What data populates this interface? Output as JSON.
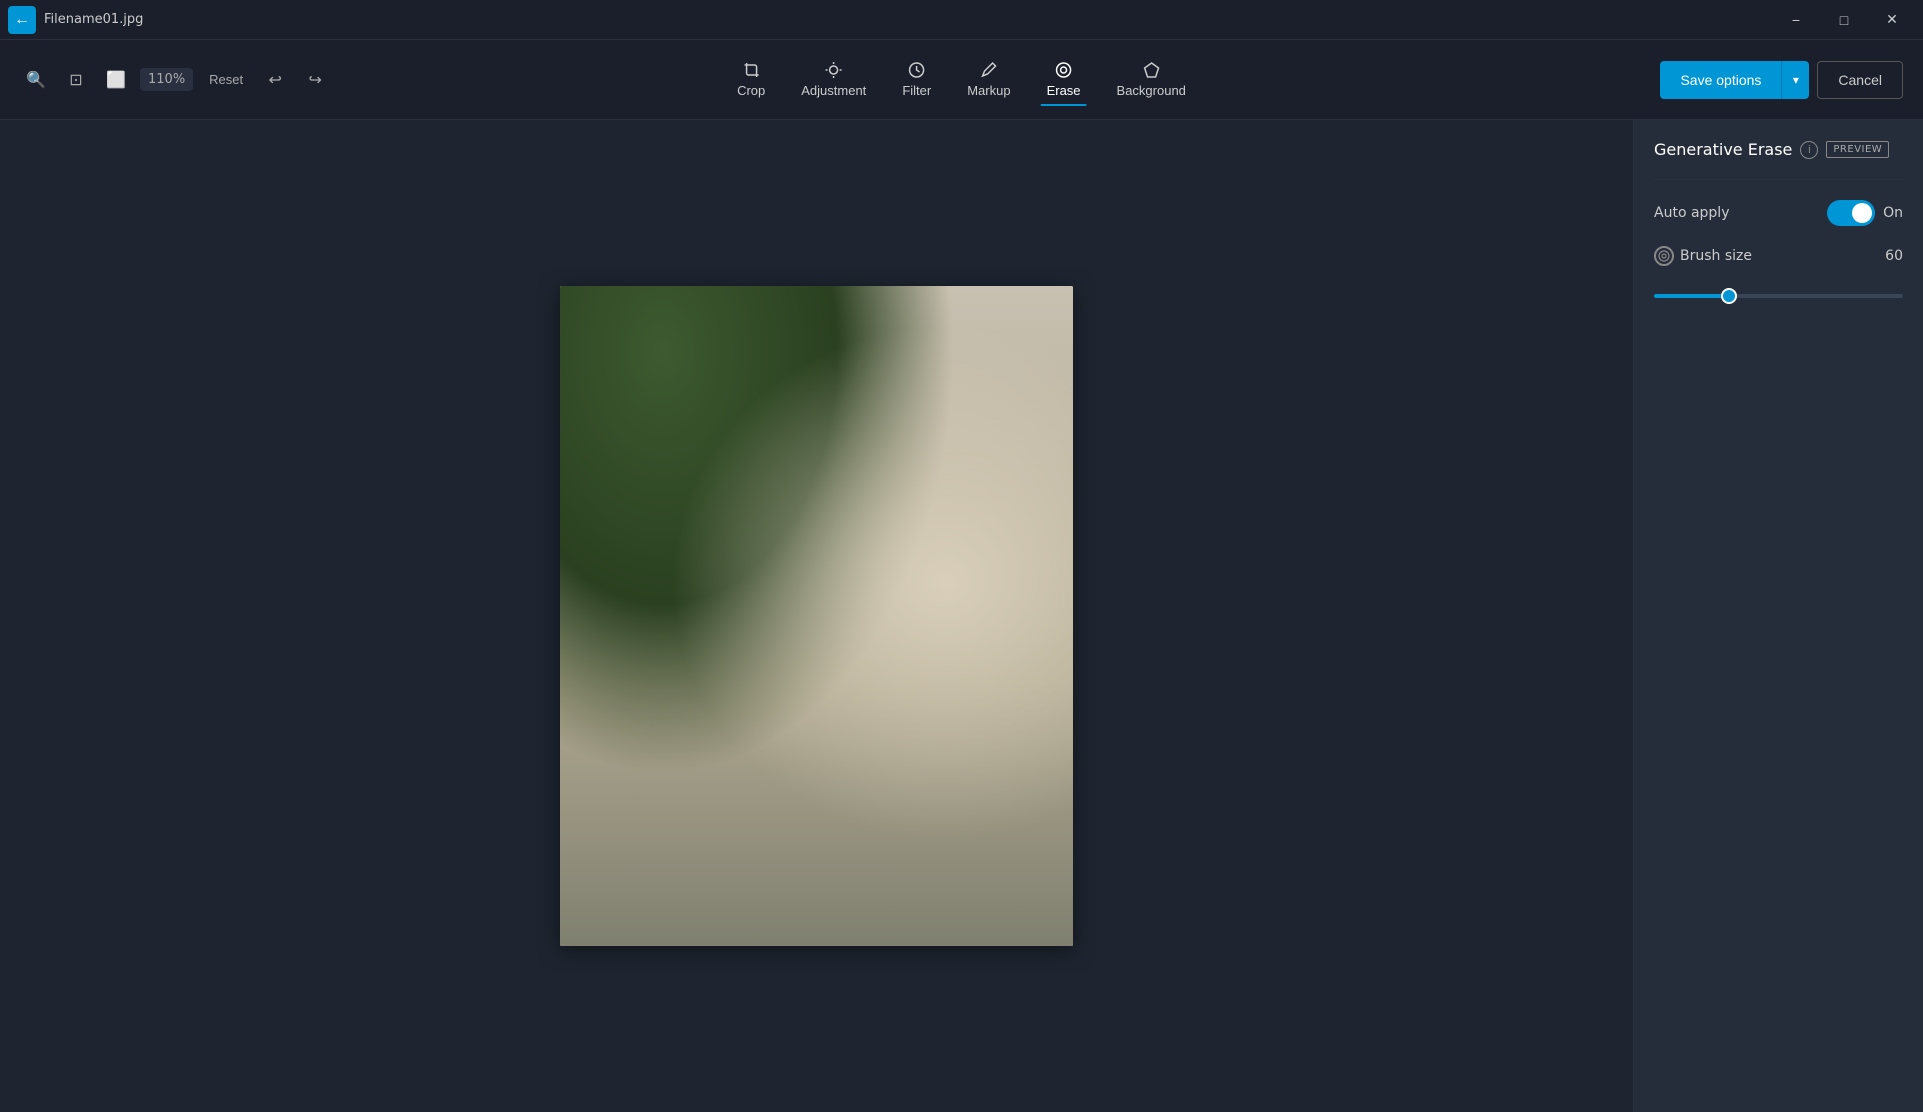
{
  "titleBar": {
    "filename": "Filename01.jpg",
    "backIcon": "←",
    "minIcon": "−",
    "maxIcon": "□",
    "closeIcon": "✕"
  },
  "toolbar": {
    "zoomOut": "−",
    "zoomFit": "⊡",
    "zoomIn": "+",
    "zoomLevel": "110%",
    "resetLabel": "Reset",
    "undoIcon": "↩",
    "redoIcon": "↪",
    "navItems": [
      {
        "id": "crop",
        "label": "Crop",
        "icon": "⊡",
        "active": false
      },
      {
        "id": "adjustment",
        "label": "Adjustment",
        "icon": "☀",
        "active": false
      },
      {
        "id": "filter",
        "label": "Filter",
        "icon": "⊕",
        "active": false
      },
      {
        "id": "markup",
        "label": "Markup",
        "icon": "✏",
        "active": false
      },
      {
        "id": "erase",
        "label": "Erase",
        "icon": "◎",
        "active": true
      },
      {
        "id": "background",
        "label": "Background",
        "icon": "⬡",
        "active": false
      }
    ],
    "saveOptions": "Save options",
    "cancelLabel": "Cancel",
    "dropdownIcon": "▾"
  },
  "rightPanel": {
    "title": "Generative Erase",
    "infoIcon": "i",
    "previewBadge": "PREVIEW",
    "autoApplyLabel": "Auto apply",
    "autoApplyState": "On",
    "brushSizeLabel": "Brush size",
    "brushSizeValue": "60",
    "brushIcon": "◉",
    "sliderFillPercent": 30,
    "accentColor": "#0095d5"
  }
}
